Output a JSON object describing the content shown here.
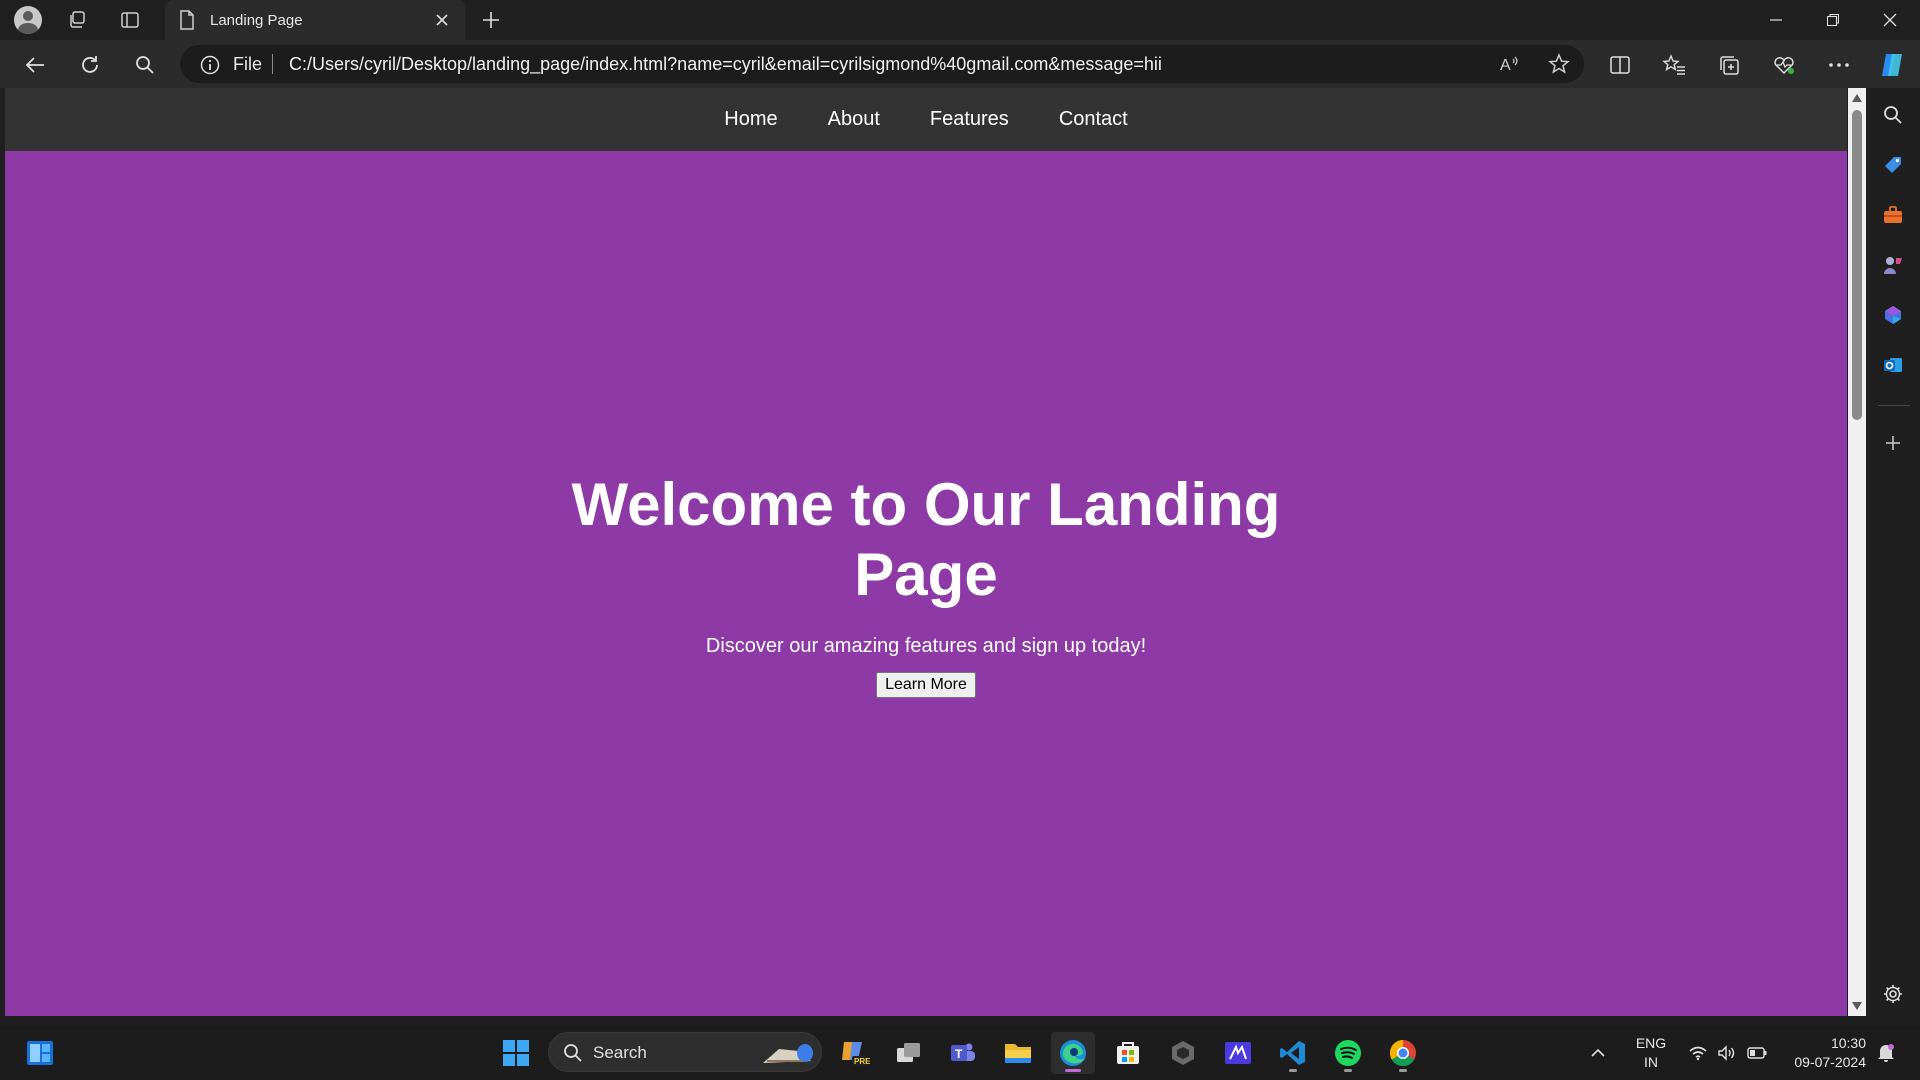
{
  "browser": {
    "tab_title": "Landing Page",
    "address": {
      "scheme_label": "File",
      "url": "C:/Users/cyril/Desktop/landing_page/index.html?name=cyril&email=cyrilsigmond%40gmail.com&message=hii"
    }
  },
  "page": {
    "nav": [
      "Home",
      "About",
      "Features",
      "Contact"
    ],
    "hero": {
      "title": "Welcome to Our Landing Page",
      "subtitle": "Discover our amazing features and sign up today!",
      "button": "Learn More"
    },
    "colors": {
      "navbar": "#333333",
      "hero_background": "#8e3aa6",
      "text": "#ffffff"
    }
  },
  "taskbar": {
    "search_label": "Search",
    "language": "ENG",
    "region": "IN",
    "time": "10:30",
    "date": "09-07-2024"
  },
  "icons": {
    "tabstrip": [
      "profile-avatar",
      "workspaces-icon",
      "vertical-tabs-icon",
      "page-icon",
      "close-icon",
      "plus-icon"
    ],
    "toolbar": [
      "back-arrow-icon",
      "refresh-icon",
      "search-icon",
      "info-icon",
      "read-aloud-icon",
      "favorite-star-icon",
      "split-screen-icon",
      "favorites-icon",
      "collections-icon",
      "browser-essentials-icon",
      "more-icon",
      "copilot-icon"
    ],
    "sidebar": [
      "search-icon",
      "shopping-tag-icon",
      "tools-icon",
      "games-icon",
      "m365-icon",
      "outlook-icon",
      "plus-icon",
      "settings-gear-icon"
    ],
    "taskbar": [
      "widgets-icon",
      "start-icon",
      "search-icon",
      "copilot-pre-icon",
      "task-view-icon",
      "teams-icon",
      "file-explorer-icon",
      "edge-icon",
      "store-icon",
      "app-icon",
      "powerapps-icon",
      "vscode-icon",
      "spotify-icon",
      "chrome-icon",
      "chevron-up-icon",
      "wifi-icon",
      "volume-icon",
      "battery-icon",
      "notification-bell-icon"
    ]
  }
}
